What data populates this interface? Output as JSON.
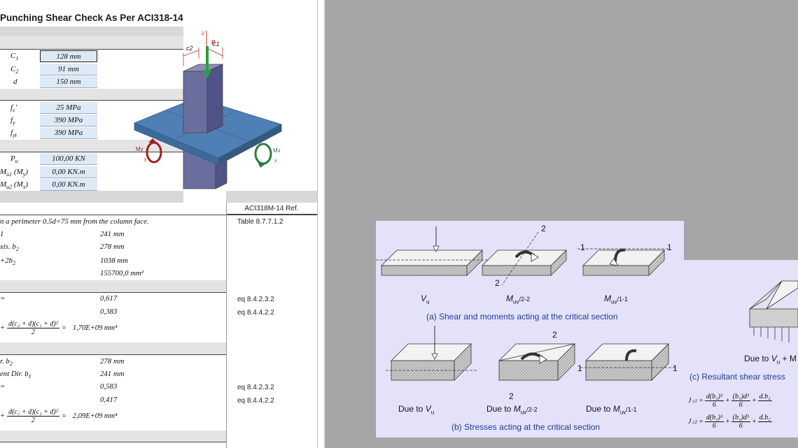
{
  "sheet": {
    "title": "Punching Shear Check As Per ACI318-14",
    "geometry": [
      {
        "label": "C",
        "sub": "1",
        "value": "128 mm"
      },
      {
        "label": "C",
        "sub": "2",
        "value": "91 mm"
      },
      {
        "label": "d",
        "sub": "",
        "value": "150 mm"
      }
    ],
    "materials": [
      {
        "label": "f",
        "sub": "c",
        "suffix": "'",
        "value": "25 MPa"
      },
      {
        "label": "f",
        "sub": "y",
        "suffix": "",
        "value": "390 MPa"
      },
      {
        "label": "f",
        "sub": "yt",
        "suffix": "",
        "value": "390 MPa"
      }
    ],
    "loads": [
      {
        "label": "P",
        "sub": "u",
        "tail": "",
        "value": "100,00 KN"
      },
      {
        "label": "M",
        "sub": "u1",
        "tail": "(M",
        "tailsub": "y",
        "value": "0,00 KN.m"
      },
      {
        "label": "M",
        "sub": "u2",
        "tail": "(M",
        "tailsub": "x",
        "value": "0,00 KN.m"
      }
    ],
    "ref_header": "ACI318M-14 Ref.",
    "perimeter_text": "n a perimeter 0.5d=75 mm from the column face.",
    "perimeter_ref": "Table 8.7.7.1.2",
    "dir1": {
      "r1_label": "1",
      "r1_value": "241 mm",
      "r2_label": "xis.  b",
      "r2_sub": "2",
      "r2_value": "278 mm",
      "r3_label": "+2b",
      "r3_sub": "2",
      "r3_value": "1038 mm",
      "r4_value": "155700,0 mm²",
      "g1_label": "=",
      "g1_value": "0,617",
      "g1_ref": "eq 8.4.2.3.2",
      "g2_value": "0,383",
      "g2_ref": "eq 8.4.4.2.2",
      "j_num": "d(c₂ + d)(c₁ + d)²",
      "j_den": "2",
      "j_value": "1,70E+09  mm⁴"
    },
    "dir2": {
      "r1_label": "r.  b",
      "r1_sub": "2",
      "r1_value": "278 mm",
      "r2_label": "ent Dir.  b",
      "r2_sub": "1",
      "r2_value": "241 mm",
      "g1_label": "=",
      "g1_value": "0,583",
      "g1_ref": "eq 8.4.2.3.2",
      "g2_value": "0,417",
      "g2_ref": "eq 8.4.4.2.2",
      "j_num": "d(c₁ + d)(c₂ + d)²",
      "j_den": "2",
      "j_value": "2,09E+09  mm⁴"
    },
    "figure": {
      "z": "z",
      "p": "P",
      "c1": "c1",
      "c2": "c2",
      "my": "My",
      "mx": "Mx",
      "y": "y",
      "x": "x"
    }
  },
  "fig1": {
    "caption_a": "(a) Shear and moments acting at the critical section",
    "caption_b": "(b) Stresses acting at the critical section",
    "lbl_vu": "V",
    "lbl_vu_sub": "u",
    "lbl_m22": "M",
    "lbl_m22_sub": "uv",
    "lbl_m22_tail": "/2-2",
    "lbl_m11": "M",
    "lbl_m11_sub": "uv",
    "lbl_m11_tail": "/1-1",
    "due": "Due to",
    "n1": "1",
    "n2": "2"
  },
  "fig2": {
    "due_text": "Due to",
    "due_var": "V",
    "due_sub": "u",
    "due_tail": "+ M",
    "caption_c": "(c) Resultant shear stress",
    "jc1_lhs": "J",
    "jc1_sub": "c1",
    "jc2_lhs": "J",
    "jc2_sub": "c2",
    "t1_num": "d(b₁)³",
    "t1_den": "6",
    "t2_num": "(b₁)d³",
    "t2_den": "6",
    "t3a_num": "d.b₂",
    "t3b_num": "d.b₂"
  }
}
